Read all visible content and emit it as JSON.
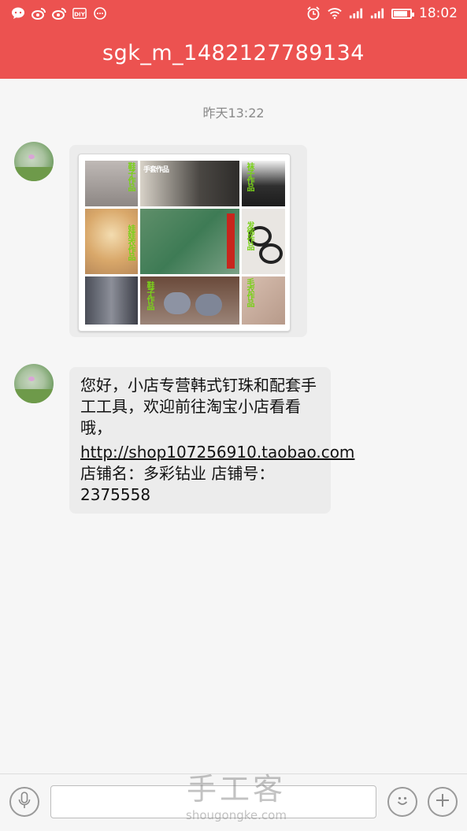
{
  "status_bar": {
    "time": "18:02",
    "left_icons": [
      "chat-icon",
      "weibo-icon",
      "weibo-icon",
      "diy-icon",
      "more-icon"
    ],
    "right_icons": [
      "alarm-icon",
      "wifi-icon",
      "signal-icon",
      "signal-icon",
      "battery-icon"
    ],
    "battery_level": 0.85,
    "diy_label": "DIY"
  },
  "header": {
    "title": "sgk_m_1482127789134"
  },
  "conversation": {
    "timestamp": "昨天13:22",
    "messages": [
      {
        "type": "image",
        "sender": "avatar",
        "collage_captions": [
          "鞋子作品",
          "手套作品",
          "袜子作品",
          "娃娃衣作品",
          "发饰作品",
          "鞋子作品",
          "毛衣作品"
        ]
      },
      {
        "type": "text",
        "line1": "您好，小店专营韩式钉珠和配套手工工具，欢迎前往淘宝小店看看哦，",
        "link": "http://shop107256910.taobao.com",
        "line2": "店铺名：多彩钻业 店铺号：2375558"
      }
    ]
  },
  "input_bar": {
    "voice_icon": "microphone-icon",
    "input_value": "",
    "emoji_icon": "smiley-icon",
    "plus_icon": "plus-icon"
  },
  "watermark": {
    "big": "手工客",
    "small": "shougongke.com"
  },
  "colors": {
    "brand": "#ec5250",
    "bubble": "#ececec",
    "background": "#f6f6f6"
  }
}
